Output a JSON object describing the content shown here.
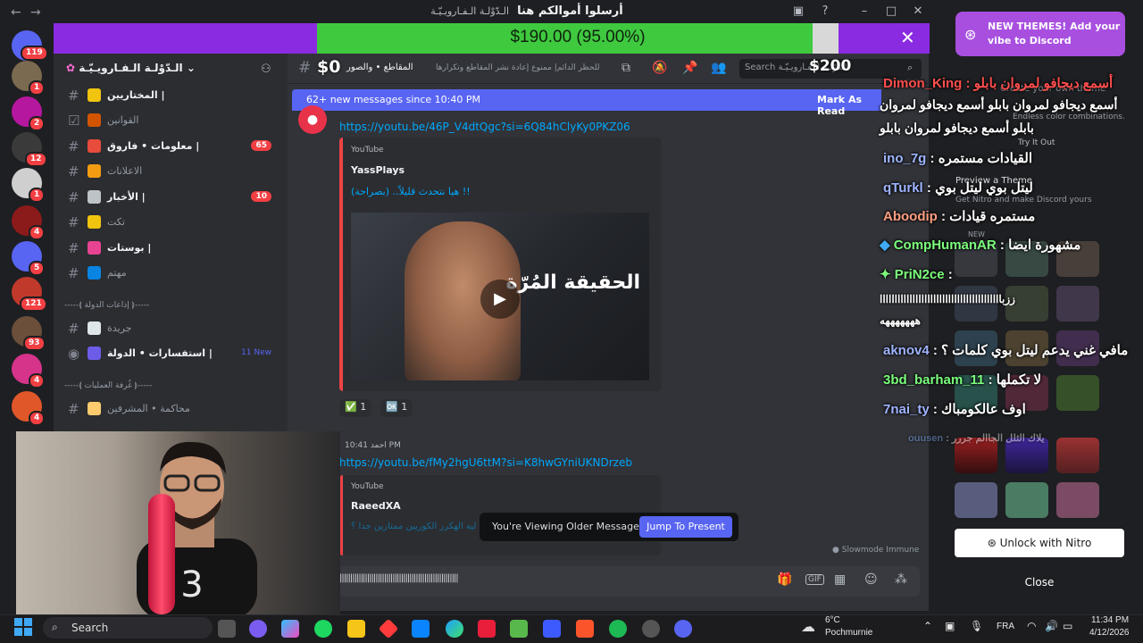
{
  "titlebar": {
    "title": "أرسلوا أموالكم هنا",
    "server_label": "الـدّوْلـة الـفـارويـيّـة"
  },
  "goal": {
    "text": "$190.00 (95.00%)",
    "progress": 0.95
  },
  "rail": {
    "badges": [
      "119",
      "1",
      "2",
      "12",
      "1",
      "4",
      "5",
      "121",
      "93",
      "4",
      "4"
    ]
  },
  "sidebar": {
    "server_name": "الـدّوْلـة الـفـارويـيّـة",
    "channels": [
      {
        "name": "المختاريين |",
        "bold": true
      },
      {
        "name": "القوانين"
      },
      {
        "name": "معلومات • فاروق |",
        "bold": true,
        "count": "65"
      },
      {
        "name": "الاعلانات"
      },
      {
        "name": "الأخبار |",
        "bold": true,
        "count": "10"
      },
      {
        "name": "تكت"
      },
      {
        "name": "بوستات |",
        "bold": true
      },
      {
        "name": "مهتم"
      }
    ],
    "category1": "-----⟬ إذاعات الدولة ⟭-----",
    "channels2": [
      {
        "name": "جريدة"
      },
      {
        "name": "استفسارات • الدولة |",
        "bold": true,
        "new": "11 New"
      }
    ],
    "category2": "-----⟬ غُرفة العمليات ⟭-----",
    "channels3": [
      {
        "name": "محاكمة • المشرفين"
      }
    ]
  },
  "header": {
    "channel_name": "المقاطع • والصور",
    "topic": "للحظر الدائم| ممنوع إعادة نشر المقاطع وتكرارها",
    "overlay_left": "$0",
    "overlay_right": "$200",
    "search_placeholder": "Search الـدّوْلـة الـفـارويـيّـة"
  },
  "messages": {
    "new_bar": "62+ new messages since 10:40 PM",
    "mark_read": "Mark As Read",
    "msg1": {
      "link": "https://youtu.be/46P_V4dtQgc?si=6Q84hClyKy0PKZ06",
      "provider": "YouTube",
      "author": "YassPlays",
      "title": "هيا نتحدث قليلاً.. (بصراحة) !!",
      "thumb_text": "الحقيقة المُرّة",
      "reactions": [
        {
          "emoji": "✅",
          "count": "1"
        },
        {
          "emoji": "🆗",
          "count": "1"
        }
      ]
    },
    "msg2": {
      "author": "احمد",
      "time": "10:41 PM",
      "link": "https://youtu.be/fMy2hgU6ttM?si=K8hwGYniUKNDrzeb",
      "provider": "YouTube",
      "embed_author": "RaeedXA",
      "embed_title": "ليه الهكرز الكوريين ممتازين جدا ؟"
    },
    "viewing": "You're Viewing Older Messages",
    "jump": "Jump To Present",
    "slowmode": "Slowmode Immune",
    "composer_text": "||||||||||||||||||||||||||||||||||||||||||||||||||||||||"
  },
  "overlay_chat": [
    {
      "user": "Dimon_King",
      "text": ": أسمع ديجافو لمروان بابلو"
    },
    {
      "user": "",
      "text": "أسمع ديجافو لمروان بابلو أسمع ديجافو لمروان"
    },
    {
      "user": "",
      "text": "بابلو أسمع ديجافو لمروان بابلو"
    },
    {
      "user": "ino_7g",
      "text": ": القيادات مستمره"
    },
    {
      "user": "qTurkl",
      "text": ": ليتل بوي ليتل بوي"
    },
    {
      "user": "Aboodip",
      "text": ": مستمره قيادات"
    },
    {
      "user": "CompHumanAR",
      "text": ": مشهورة ايضا"
    },
    {
      "user": "PriN2ce",
      "text": ":"
    },
    {
      "user": "",
      "text": "ززبااااااااااااااااااااااااااااااااااااااااا"
    },
    {
      "user": "",
      "text": "هههههههه"
    },
    {
      "user": "aknov4",
      "text": ": مافي غني يدعم ليتل بوي كلمات ؟"
    },
    {
      "user": "3bd_barham_11",
      "text": ": لا تكملها"
    },
    {
      "user": "7nai_ty",
      "text": ": اوف عالكومباك"
    },
    {
      "user": "ouusen",
      "text": ": يلاك الثلل الجاالم جررر"
    }
  ],
  "nitro": {
    "themes_popup": "NEW THEMES! Add your vibe to Discord",
    "create_theme": "Create your own theme",
    "endless": "Endless color combinations.",
    "try_it": "Try It Out",
    "preview": "Preview a Theme",
    "get_nitro": "Get Nitro and make Discord yours",
    "new_label": "NEW",
    "unlock": "Unlock with Nitro",
    "close": "Close"
  },
  "taskbar": {
    "search": "Search",
    "weather_temp": "6°C",
    "weather_desc": "Pochmurnie",
    "lang": "FRA",
    "time": "11:34 PM",
    "date": "4/12/2026"
  },
  "colors": {
    "accent": "#5865f2",
    "goal_fill": "#3fc93f",
    "goal_bg": "#8a2be2",
    "nitro_popup": "#a84fe0",
    "badge": "#f23f43"
  }
}
